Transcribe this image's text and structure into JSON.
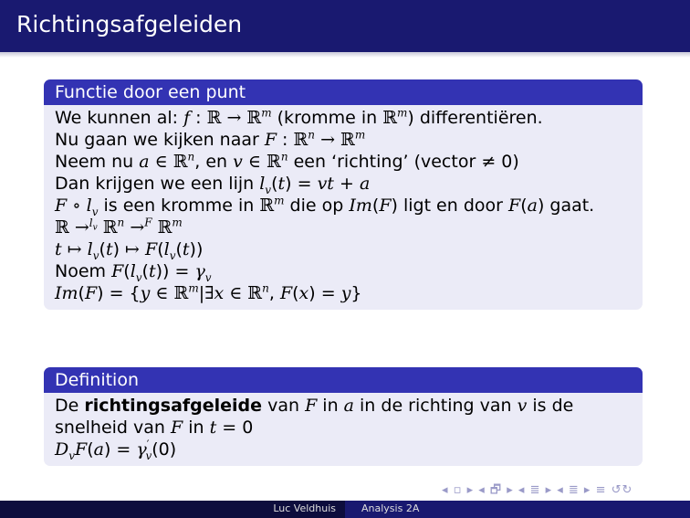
{
  "slide": {
    "title": "Richtingsafgeleiden"
  },
  "block1": {
    "title": "Functie door een punt",
    "lines": [
      "We kunnen al: f : ℝ → ℝᵐ (kromme in ℝᵐ) differentiëren.",
      "Nu gaan we kijken naar F : ℝⁿ → ℝᵐ",
      "Neem nu a ∈ ℝⁿ, en v ∈ ℝⁿ een ‘richting’ (vector ≠ 0)",
      "Dan krijgen we een lijn lᵥ(t) = vt + a",
      "F ∘ lᵥ is een kromme in ℝᵐ die op Im(F) ligt en door F(a) gaat.",
      "ℝ →^{lᵥ} ℝⁿ →^F ℝᵐ",
      "t ↦ lᵥ(t) ↦ F(lᵥ(t))",
      "Noem F(lᵥ(t)) = γᵥ",
      "Im(F) = {y ∈ ℝᵐ|∃x ∈ ℝⁿ, F(x) = y}"
    ]
  },
  "block2": {
    "title": "Definition",
    "lines": [
      "De richtingsafgeleide van F in a in de richting van v is de",
      "snelheid van F in t = 0",
      "DᵥF(a) = γ′ᵥ(0)"
    ]
  },
  "nav": {
    "symbols": "◂ ▫ ▸ ◂ 🗗 ▸ ◂ ≣ ▸ ◂ ≣ ▸ ≡ ↺↻"
  },
  "footer": {
    "author": "Luc Veldhuis",
    "talk": "Analysis 2A"
  }
}
